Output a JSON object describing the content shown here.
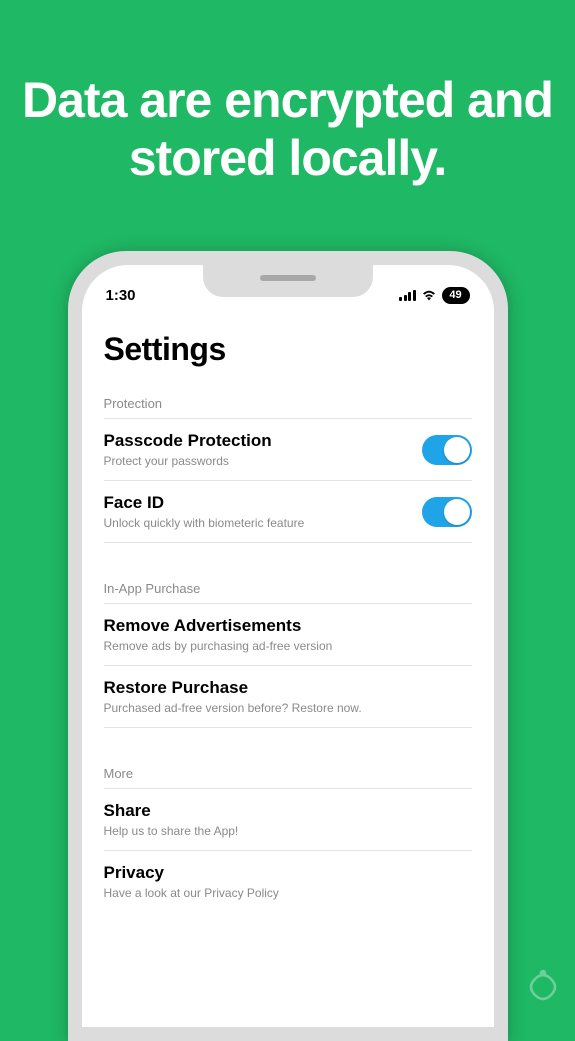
{
  "headline": "Data are encrypted and stored locally.",
  "status": {
    "time": "1:30",
    "battery": "49"
  },
  "page_title": "Settings",
  "sections": {
    "protection": {
      "header": "Protection",
      "passcode": {
        "title": "Passcode Protection",
        "sub": "Protect your passwords"
      },
      "faceid": {
        "title": "Face ID",
        "sub": "Unlock quickly with biometeric feature"
      }
    },
    "iap": {
      "header": "In-App Purchase",
      "remove_ads": {
        "title": "Remove Advertisements",
        "sub": "Remove ads by purchasing ad-free version"
      },
      "restore": {
        "title": "Restore Purchase",
        "sub": "Purchased ad-free version before? Restore now."
      }
    },
    "more": {
      "header": "More",
      "share": {
        "title": "Share",
        "sub": "Help us to share the App!"
      },
      "privacy": {
        "title": "Privacy",
        "sub": "Have a look at our Privacy Policy"
      }
    }
  }
}
